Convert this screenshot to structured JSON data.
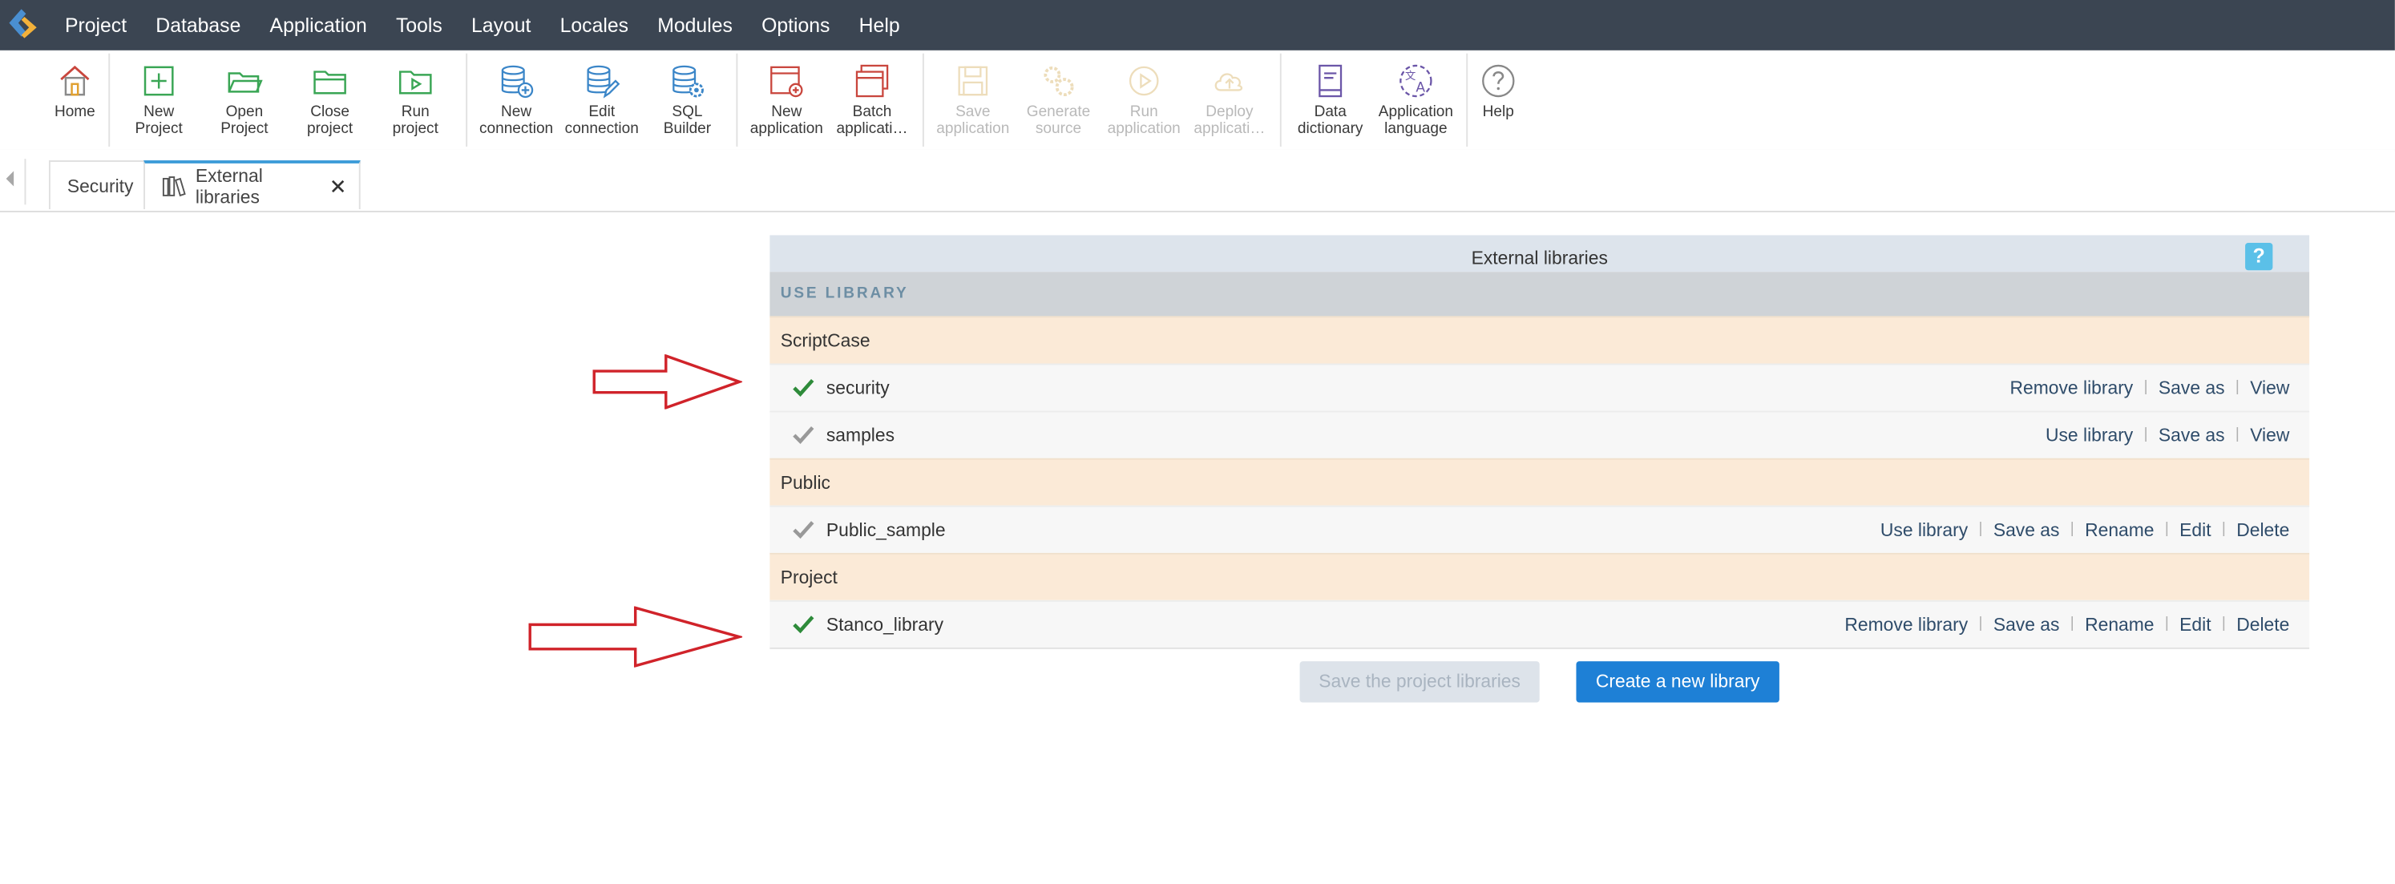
{
  "menubar": {
    "items": [
      "Project",
      "Database",
      "Application",
      "Tools",
      "Layout",
      "Locales",
      "Modules",
      "Options",
      "Help"
    ]
  },
  "toolbar": {
    "home": {
      "label": "Home",
      "icon": "home-icon"
    },
    "new_project": {
      "label": "New\nProject",
      "icon": "plus-box-icon"
    },
    "open_project": {
      "label": "Open\nProject",
      "icon": "folder-open-icon"
    },
    "close_project": {
      "label": "Close\nproject",
      "icon": "folder-close-icon"
    },
    "run_project": {
      "label": "Run\nproject",
      "icon": "folder-play-icon"
    },
    "new_connection": {
      "label": "New\nconnection",
      "icon": "database-add-icon"
    },
    "edit_connection": {
      "label": "Edit\nconnection",
      "icon": "database-edit-icon"
    },
    "sql_builder": {
      "label": "SQL\nBuilder",
      "icon": "database-gear-icon"
    },
    "new_application": {
      "label": "New\napplication",
      "icon": "window-add-icon"
    },
    "batch_application": {
      "label": "Batch\napplicati…",
      "icon": "window-stack-icon"
    },
    "save_application": {
      "label": "Save\napplication",
      "icon": "save-icon"
    },
    "generate_source": {
      "label": "Generate\nsource",
      "icon": "gears-icon"
    },
    "run_application": {
      "label": "Run\napplication",
      "icon": "play-circle-icon"
    },
    "deploy_application": {
      "label": "Deploy\napplicati…",
      "icon": "cloud-upload-icon"
    },
    "data_dictionary": {
      "label": "Data\ndictionary",
      "icon": "book-icon"
    },
    "application_language": {
      "label": "Application\nlanguage",
      "icon": "translate-icon"
    },
    "help": {
      "label": "Help",
      "icon": "question-circle-icon"
    }
  },
  "tabs": {
    "security": "Security",
    "external_libraries": "External libraries"
  },
  "panel": {
    "title": "External libraries",
    "help": "?",
    "section": "USE LIBRARY",
    "groups": {
      "scriptcase": "ScriptCase",
      "public": "Public",
      "project": "Project"
    },
    "libraries": {
      "security": {
        "name": "security",
        "checked": true,
        "actions": [
          "Remove library",
          "Save as",
          "View"
        ]
      },
      "samples": {
        "name": "samples",
        "checked": false,
        "actions": [
          "Use library",
          "Save as",
          "View"
        ]
      },
      "public_sample": {
        "name": "Public_sample",
        "checked": false,
        "actions": [
          "Use library",
          "Save as",
          "Rename",
          "Edit",
          "Delete"
        ]
      },
      "stanco_library": {
        "name": "Stanco_library",
        "checked": true,
        "actions": [
          "Remove library",
          "Save as",
          "Rename",
          "Edit",
          "Delete"
        ]
      }
    }
  },
  "buttons": {
    "save_project_libraries": "Save the project libraries",
    "create_new_library": "Create a new library"
  },
  "colors": {
    "menubar_bg": "#3b4552",
    "accent_blue": "#1e80d6",
    "check_active": "#2e8b3a",
    "check_inactive": "#999999",
    "group_row_bg": "#fbead7",
    "arrow_red": "#d0232a"
  }
}
